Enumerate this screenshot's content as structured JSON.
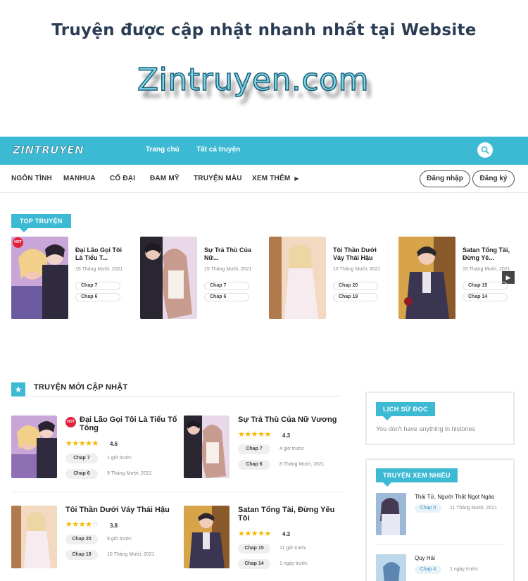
{
  "banner": {
    "tagline": "Truyện được cập nhật nhanh nhất tại Website",
    "site_name": "Zintruyen.com"
  },
  "header": {
    "logo": "ZINTRUYEN",
    "nav": [
      "Trang chủ",
      "Tất cả truyện"
    ]
  },
  "categories": [
    "NGÔN TÌNH",
    "MANHUA",
    "CỔ ĐẠI",
    "ĐAM MỸ",
    "TRUYỆN MÀU",
    "XEM THÊM"
  ],
  "auth": {
    "login": "Đăng nhập",
    "register": "Đăng ký"
  },
  "top": {
    "heading": "TOP TRUYỆN",
    "items": [
      {
        "title": "Đại Lão Gọi Tôi Là Tiểu T...",
        "date": "15 Tháng Mười, 2021",
        "chapters": [
          "Chap 7",
          "Chap 6"
        ],
        "hot": "HOT"
      },
      {
        "title": "Sự Trả Thù Của Nữ...",
        "date": "15 Tháng Mười, 2021",
        "chapters": [
          "Chap 7",
          "Chap 6"
        ]
      },
      {
        "title": "Tôi Thần Dưới Váy Thái Hậu",
        "date": "15 Tháng Mười, 2021",
        "chapters": [
          "Chap 20",
          "Chap 19"
        ]
      },
      {
        "title": "Satan Tổng Tài, Đừng Yê...",
        "date": "15 Tháng Mười, 2021",
        "chapters": [
          "Chap 15",
          "Chap 14"
        ]
      }
    ]
  },
  "new_updates": {
    "heading": "TRUYỆN MỚI CẬP NHẬT",
    "items": [
      {
        "title": "Đại Lão Gọi Tôi Là Tiểu Tổ Tông",
        "hot": "HOT",
        "rating": "4.6",
        "stars": 4.6,
        "chapters": [
          {
            "label": "Chap 7",
            "time": "1 giờ trước"
          },
          {
            "label": "Chap 6",
            "time": "9 Tháng Mười, 2021"
          }
        ]
      },
      {
        "title": "Sự Trả Thù Của Nữ Vương",
        "rating": "4.3",
        "stars": 4.3,
        "chapters": [
          {
            "label": "Chap 7",
            "time": "4 giờ trước"
          },
          {
            "label": "Chap 6",
            "time": "8 Tháng Mười, 2021"
          }
        ]
      },
      {
        "title": "Tôi Thần Dưới Váy Thái Hậu",
        "rating": "3.8",
        "stars": 3.8,
        "chapters": [
          {
            "label": "Chap 20",
            "time": "9 giờ trước"
          },
          {
            "label": "Chap 19",
            "time": "10 Tháng Mười, 2021"
          }
        ]
      },
      {
        "title": "Satan Tổng Tài, Đừng Yêu Tôi",
        "rating": "4.3",
        "stars": 4.3,
        "chapters": [
          {
            "label": "Chap 15",
            "time": "11 giờ trước"
          },
          {
            "label": "Chap 14",
            "time": "1 ngày trước"
          }
        ]
      }
    ]
  },
  "history": {
    "heading": "LỊCH SỬ ĐỌC",
    "empty": "You don't have anything in histories"
  },
  "popular": {
    "heading": "TRUYỆN XEM NHIỀU",
    "items": [
      {
        "title": "Thái Tử, Người Thật Ngọt Ngào",
        "chapter": "Chap 0",
        "time": "11 Tháng Mười, 2021"
      },
      {
        "title": "Quy Hải",
        "chapter": "Chap 4",
        "time": "1 ngày trước"
      }
    ]
  },
  "colors": {
    "accent": "#3dbad3",
    "hot": "#e5203a",
    "star": "#f5b700"
  }
}
